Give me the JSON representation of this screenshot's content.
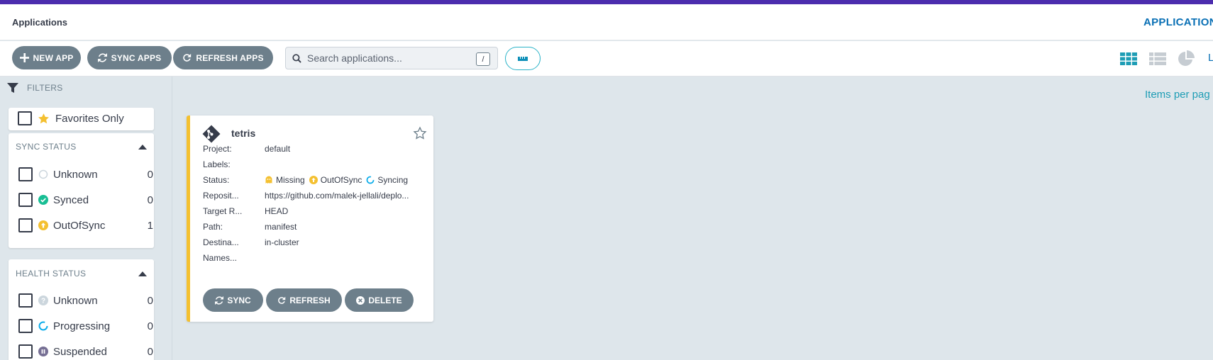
{
  "header": {
    "title": "Applications",
    "right_title": "APPLICATIONS"
  },
  "toolbar": {
    "new_app": "NEW APP",
    "sync_apps": "SYNC APPS",
    "refresh_apps": "REFRESH APPS",
    "search_placeholder": "Search applications...",
    "search_shortcut": "/"
  },
  "view_switch": {
    "tiles_icon": "grid-icon",
    "list_icon": "list-icon",
    "summary_icon": "pie-chart-icon",
    "partial_label": "L"
  },
  "filters": {
    "label": "FILTERS",
    "favorites_label": "Favorites Only",
    "sync_status": {
      "title": "SYNC STATUS",
      "items": [
        {
          "label": "Unknown",
          "count": "0",
          "icon": "circle-outline-icon"
        },
        {
          "label": "Synced",
          "count": "0",
          "icon": "check-circle-icon"
        },
        {
          "label": "OutOfSync",
          "count": "1",
          "icon": "arrow-up-circle-icon"
        }
      ]
    },
    "health_status": {
      "title": "HEALTH STATUS",
      "items": [
        {
          "label": "Unknown",
          "count": "0",
          "icon": "question-circle-icon"
        },
        {
          "label": "Progressing",
          "count": "0",
          "icon": "progress-circle-icon"
        },
        {
          "label": "Suspended",
          "count": "0",
          "icon": "pause-circle-icon"
        }
      ]
    }
  },
  "pagination": {
    "items_per_page": "Items per pag"
  },
  "card": {
    "name": "tetris",
    "project_label": "Project:",
    "project": "default",
    "labels_label": "Labels:",
    "labels": "",
    "status_label": "Status:",
    "status_health": "Missing",
    "status_sync": "OutOfSync",
    "status_op": "Syncing",
    "repo_label": "Reposit...",
    "repo": "https://github.com/malek-jellali/deplo...",
    "target_label": "Target R...",
    "target": "HEAD",
    "path_label": "Path:",
    "path": "manifest",
    "dest_label": "Destina...",
    "dest": "in-cluster",
    "ns_label": "Names...",
    "ns": "",
    "sync_btn": "SYNC",
    "refresh_btn": "REFRESH",
    "delete_btn": "DELETE"
  },
  "colors": {
    "accent_bar": "#4c2dae",
    "button": "#6d7f8b",
    "card_border": "#f4c030",
    "synced": "#18be94",
    "outofsync": "#f4c030",
    "progressing": "#0dadea",
    "link": "#0a70b5"
  }
}
